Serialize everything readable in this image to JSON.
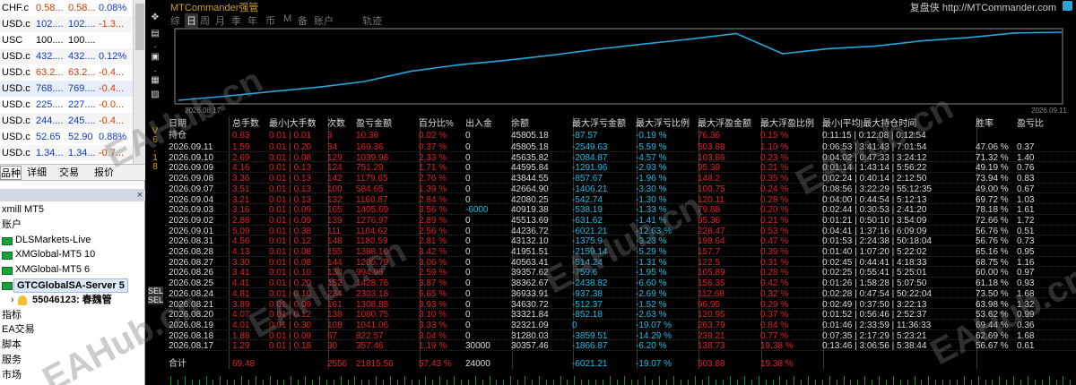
{
  "market_watch": {
    "rows": [
      {
        "symbol": "CHF.c",
        "bid": "0.58...",
        "ask": "0.58...",
        "change": "0.08%",
        "bid_color": "#d23b00",
        "ask_color": "#d23b00",
        "change_color": "#0b39c6",
        "bg": "#ffffff"
      },
      {
        "symbol": "USD.c",
        "bid": "102....",
        "ask": "102....",
        "change": "-1.3...",
        "bid_color": "#0b39c6",
        "ask_color": "#0b39c6",
        "change_color": "#d23b00",
        "bg": "#f5f5f5"
      },
      {
        "symbol": "USC",
        "bid": "100....",
        "ask": "100....",
        "change": "",
        "bid_color": "#000000",
        "ask_color": "#000000",
        "change_color": "#000000",
        "bg": "#ffffff"
      },
      {
        "symbol": "USD.c",
        "bid": "432....",
        "ask": "432....",
        "change": "0.12%",
        "bid_color": "#0b39c6",
        "ask_color": "#0b39c6",
        "change_color": "#0b39c6",
        "bg": "#f5f5f5"
      },
      {
        "symbol": "USD.c",
        "bid": "63.2...",
        "ask": "63.2...",
        "change": "-0.4...",
        "bid_color": "#d23b00",
        "ask_color": "#d23b00",
        "change_color": "#d23b00",
        "bg": "#ffffff"
      },
      {
        "symbol": "USD.c",
        "bid": "768....",
        "ask": "769....",
        "change": "-0.4...",
        "bid_color": "#0b39c6",
        "ask_color": "#0b39c6",
        "change_color": "#d23b00",
        "bg": "#e8eefb"
      },
      {
        "symbol": "USD.c",
        "bid": "225....",
        "ask": "227....",
        "change": "-0.0...",
        "bid_color": "#0b39c6",
        "ask_color": "#0b39c6",
        "change_color": "#d23b00",
        "bg": "#ffffff"
      },
      {
        "symbol": "USD.c",
        "bid": "244....",
        "ask": "245....",
        "change": "-0.4...",
        "bid_color": "#0b39c6",
        "ask_color": "#0b39c6",
        "change_color": "#d23b00",
        "bg": "#f5f5f5"
      },
      {
        "symbol": "USD.c",
        "bid": "52.65",
        "ask": "52.90",
        "change": "0.88%",
        "bid_color": "#0b39c6",
        "ask_color": "#0b39c6",
        "change_color": "#0b39c6",
        "bg": "#ffffff"
      },
      {
        "symbol": "USD.c",
        "bid": "1.34...",
        "ask": "1.34...",
        "change": "-0.7...",
        "bid_color": "#0b39c6",
        "ask_color": "#0b39c6",
        "change_color": "#d23b00",
        "bg": "#f5f5f5"
      }
    ]
  },
  "mw_tabs": [
    "品种",
    "详细",
    "交易",
    "报价"
  ],
  "navigator": {
    "close": "×",
    "items": [
      {
        "text": "xmill MT5",
        "kind": "text"
      },
      {
        "text": "账户",
        "kind": "text"
      },
      {
        "text": "DLSMarkets-Live",
        "kind": "server"
      },
      {
        "text": "XMGlobal-MT5 10",
        "kind": "server"
      },
      {
        "text": "XMGlobal-MT5 6",
        "kind": "server"
      },
      {
        "text": "GTCGlobalSA-Server 5",
        "kind": "selected"
      },
      {
        "text": "55046123: 春魏管",
        "kind": "account"
      },
      {
        "text": "指标",
        "kind": "text"
      },
      {
        "text": "EA交易",
        "kind": "text"
      },
      {
        "text": "脚本",
        "kind": "text"
      },
      {
        "text": "服务",
        "kind": "text"
      },
      {
        "text": "市场",
        "kind": "text"
      }
    ]
  },
  "axis_label": "V6.18",
  "sel_labels": [
    "SEL",
    "SEL"
  ],
  "header": {
    "title": "MTCommander强管",
    "link": "复盘侠 http://MTCommander.com"
  },
  "menu": [
    "综",
    "日",
    "周",
    "月",
    "季",
    "年",
    "币",
    "M",
    "备",
    "账户",
    "轨迹"
  ],
  "chart": {
    "start_label": "2026.08.17",
    "end_label": "2026.09.11"
  },
  "table": {
    "headers": [
      "日期",
      "总手数",
      "最小|大手数",
      "次数",
      "盈亏金额",
      "百分比%",
      "出入金",
      "余额",
      "最大浮亏金额",
      "最大浮亏比例",
      "最大浮盈金额",
      "最大浮盈比例",
      "最小|平均|最大持仓时间",
      "胜率",
      "盈亏比"
    ],
    "holding_row": [
      "持仓",
      "0.63",
      "0.01 | 0.01",
      "3",
      "10.38",
      "0.02 %",
      "0",
      "45805.18",
      "-87.57",
      "-0.19 %",
      "76.36",
      "0.15 %",
      "0:11:15 | 0:12:08 | 0:12:54",
      "",
      ""
    ],
    "rows": [
      [
        "2026.09.11",
        "1.59",
        "0.01 | 0.20",
        "34",
        "169.36",
        "0.37 %",
        "0",
        "45805.18",
        "-2549.63",
        "-5.59 %",
        "503.88",
        "1.10 %",
        "0:06:53 | 3:41:43 | 7:01:54",
        "47.06 %",
        "0.37"
      ],
      [
        "2026.09.10",
        "2.69",
        "0.01 | 0.08",
        "129",
        "1039.98",
        "2.33 %",
        "0",
        "45635.82",
        "-2084.87",
        "-4.57 %",
        "103.86",
        "0.23 %",
        "0:04:02 | 0:47:33 | 3:24:12",
        "71.32 %",
        "1.40"
      ],
      [
        "2026.09.09",
        "4.16",
        "0.01 | 0.13",
        "124",
        "751.29",
        "1.71 %",
        "0",
        "44595.84",
        "-1291.96",
        "-2.93 %",
        "95.38",
        "0.21 %",
        "0:01:14 | 1:43:14 | 5:56:22",
        "49.19 %",
        "0.76"
      ],
      [
        "2026.09.08",
        "3.36",
        "0.01 | 0.13",
        "142",
        "1179.65",
        "2.76 %",
        "0",
        "43844.55",
        "-857.67",
        "-1.96 %",
        "148.2",
        "0.35 %",
        "0:02:24 | 0:40:14 | 2:12:50",
        "73.94 %",
        "0.83"
      ],
      [
        "2026.09.07",
        "3.51",
        "0.01 | 0.13",
        "100",
        "584.65",
        "1.39 %",
        "0",
        "42664.90",
        "-1406.21",
        "-3.30 %",
        "100.75",
        "0.24 %",
        "0:08:56 | 3:22:29 | 55:12:35",
        "49.00 %",
        "0.67"
      ],
      [
        "2026.09.04",
        "3.21",
        "0.01 | 0.13",
        "132",
        "1160.87",
        "2.84 %",
        "0",
        "42080.25",
        "-542.74",
        "-1.30 %",
        "120.11",
        "0.28 %",
        "0:04:00 | 0:44:54 | 5:12:13",
        "69.72 %",
        "1.03"
      ],
      [
        "2026.09.03",
        "3.16",
        "0.01 | 0.09",
        "165",
        "1405.69",
        "3.56 %",
        "-6000",
        "40919.38",
        "-538.19",
        "-1.33 %",
        "79.88",
        "0.20 %",
        "0:02:44 | 0:30:53 | 2:41:20",
        "78.18 %",
        "1.61"
      ],
      [
        "2026.09.02",
        "2.88",
        "0.01 | 0.09",
        "139",
        "1276.97",
        "2.89 %",
        "0",
        "45513.69",
        "-631.62",
        "-1.41 %",
        "95.36",
        "0.21 %",
        "0:01:21 | 0:50:10 | 3:54:09",
        "72.66 %",
        "1.72"
      ],
      [
        "2026.09.01",
        "5.09",
        "0.01 | 0.38",
        "111",
        "1104.62",
        "2.56 %",
        "0",
        "44236.72",
        "-6021.21",
        "-12.63 %",
        "228.47",
        "0.53 %",
        "0:04:41 | 1:37:16 | 6:09:09",
        "56.76 %",
        "0.51"
      ],
      [
        "2026.08.31",
        "4.56",
        "0.01 | 0.12",
        "148",
        "1180.59",
        "2.81 %",
        "0",
        "43132.10",
        "-1375.9",
        "-3.23 %",
        "198.64",
        "0.47 %",
        "0:01:53 | 2:24:38 | 50:18:04",
        "56.76 %",
        "0.73"
      ],
      [
        "2026.08.28",
        "4.13",
        "0.01 | 0.08",
        "155",
        "1388.10",
        "3.42 %",
        "0",
        "41951.51",
        "-2159.14",
        "-5.29 %",
        "157.7",
        "0.39 %",
        "0:01:40 | 1:07:20 | 5:22:02",
        "65.16 %",
        "0.95"
      ],
      [
        "2026.08.27",
        "3.30",
        "0.01 | 0.08",
        "144",
        "1205.79",
        "3.06 %",
        "0",
        "40563.41",
        "-514.24",
        "-1.31 %",
        "122.5",
        "0.31 %",
        "0:02:45 | 0:44:41 | 4:18:33",
        "68.75 %",
        "1.16"
      ],
      [
        "2026.08.26",
        "3.41",
        "0.01 | 0.10",
        "130",
        "994.95",
        "2.59 %",
        "0",
        "39357.62",
        "-759.6",
        "-1.95 %",
        "105.89",
        "0.28 %",
        "0:02:25 | 0:55:41 | 5:25:01",
        "60.00 %",
        "0.97"
      ],
      [
        "2026.08.25",
        "4.41",
        "0.01 | 0.20",
        "152",
        "1428.76",
        "3.87 %",
        "0",
        "38362.67",
        "-2438.82",
        "-6.60 %",
        "156.35",
        "0.42 %",
        "0:01:26 | 1:58:28 | 5:07:50",
        "61.18 %",
        "0.93"
      ],
      [
        "2026.08.24",
        "4.81",
        "0.01 | 0.10",
        "234",
        "2303.18",
        "6.65 %",
        "0",
        "36933.91",
        "-937.38",
        "-2.69 %",
        "112.68",
        "0.32 %",
        "0:02:28 | 0:47:54 | 50:22:04",
        "73.50 %",
        "1.68"
      ],
      [
        "2026.08.21",
        "3.89",
        "0.01 | 0.09",
        "161",
        "1308.88",
        "3.93 %",
        "0",
        "34630.72",
        "-512.37",
        "-1.52 %",
        "96.95",
        "0.29 %",
        "0:02:49 | 0:37:50 | 3:22:13",
        "63.98 %",
        "1.32"
      ],
      [
        "2026.08.20",
        "4.07",
        "0.01 | 0.12",
        "138",
        "1080.75",
        "3.10 %",
        "0",
        "33321.84",
        "-852.18",
        "-2.63 %",
        "120.95",
        "0.37 %",
        "0:01:52 | 0:56:46 | 2:52:37",
        "53.62 %",
        "0.99"
      ],
      [
        "2026.08.19",
        "4.01",
        "0.01 | 0.30",
        "108",
        "1041.06",
        "3.33 %",
        "0",
        "32321.09",
        "0",
        "-19.07 %",
        "263.79",
        "0.84 %",
        "0:01:46 | 2:33:59 | 11:36:33",
        "69.44 %",
        "0.36"
      ],
      [
        "2026.08.18",
        "1.88",
        "0.01 | 0.09",
        "67",
        "822.57",
        "3.04 %",
        "0",
        "31280.03",
        "-3859.51",
        "-14.29 %",
        "239.21",
        "0.77 %",
        "0:07:35 | 2:17:29 | 5:23:21",
        "62.69 %",
        "1.68"
      ],
      [
        "2026.08.17",
        "1.29",
        "0.01 | 0.18",
        "30",
        "357.46",
        "1.19 %",
        "30000",
        "30357.46",
        "-1866.87",
        "-6.20 %",
        "138.73",
        "19.38 %",
        "0:13:46 | 3:06:56 | 5:38:44",
        "56.67 %",
        "0.61"
      ]
    ],
    "total_row": [
      "合计",
      "69.48",
      "",
      "2556",
      "21815.56",
      "57.43 %",
      "24000",
      "",
      "-6021.21",
      "-19.07 %",
      "503.88",
      "19.38 %",
      "",
      "",
      ""
    ]
  },
  "colors": {
    "accent": "#d4a017",
    "red": "#e22020",
    "cyan": "#16c0e8",
    "curve": "#1fa8e0",
    "green": "#1aa33b"
  },
  "watermark": "EAHub.cn"
}
